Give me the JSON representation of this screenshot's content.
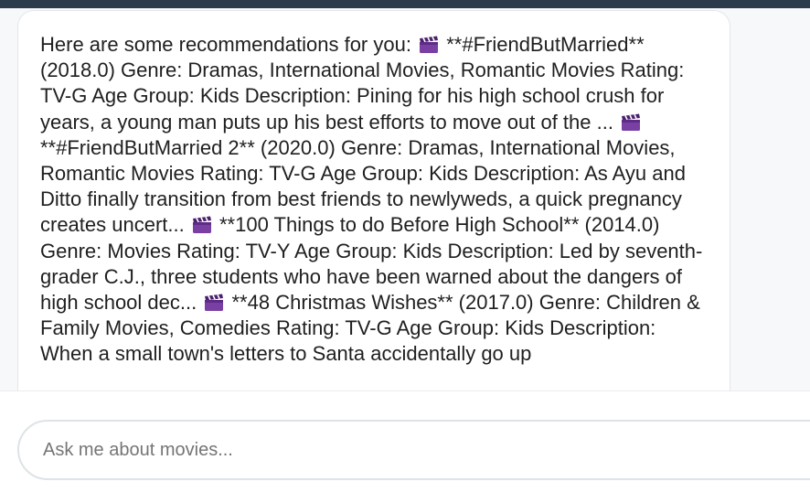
{
  "message": {
    "intro": "Here are some recommendations for you:",
    "items": [
      "**#FriendButMarried** (2018.0) Genre: Dramas, International Movies, Romantic Movies Rating: TV-G Age Group: Kids Description: Pining for his high school crush for years, a young man puts up his best efforts to move out of the ...",
      "**#FriendButMarried 2** (2020.0) Genre: Dramas, International Movies, Romantic Movies Rating: TV-G Age Group: Kids Description: As Ayu and Ditto finally transition from best friends to newlyweds, a quick pregnancy creates uncert...",
      "**100 Things to do Before High School** (2014.0) Genre: Movies Rating: TV-Y Age Group: Kids Description: Led by seventh-grader C.J., three students who have been warned about the dangers of high school dec...",
      "**48 Christmas Wishes** (2017.0) Genre: Children & Family Movies, Comedies Rating: TV-G Age Group: Kids Description: When a small town's letters to Santa accidentally go up"
    ],
    "item_icon": "clapper-board-icon"
  },
  "input": {
    "placeholder": "Ask me about movies..."
  },
  "colors": {
    "topbar": "#2c3b4c",
    "chat_background": "#f7f8fa",
    "bubble_background": "#ffffff",
    "clapper": "#7a3fa3"
  }
}
